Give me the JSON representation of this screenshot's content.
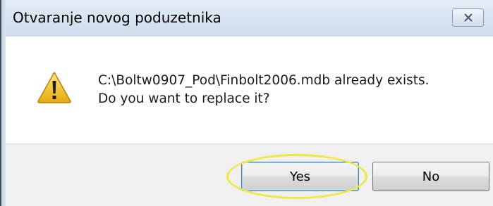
{
  "dialog": {
    "title": "Otvaranje novog poduzetnika",
    "close_icon": "close-icon",
    "message_icon": "warning-icon",
    "message_line1": "C:\\Boltw0907_Pod\\Finbolt2006.mdb already exists.",
    "message_line2": "Do you want to replace it?",
    "buttons": {
      "yes_label": "Yes",
      "no_label": "No"
    },
    "highlighted_button": "Yes"
  },
  "colors": {
    "titlebar": "#d6e3f1",
    "footer": "#f0f0f0",
    "highlight_ring": "#efe744",
    "warning_fill": "#f3c424",
    "focus_border": "#3c7fb1"
  }
}
